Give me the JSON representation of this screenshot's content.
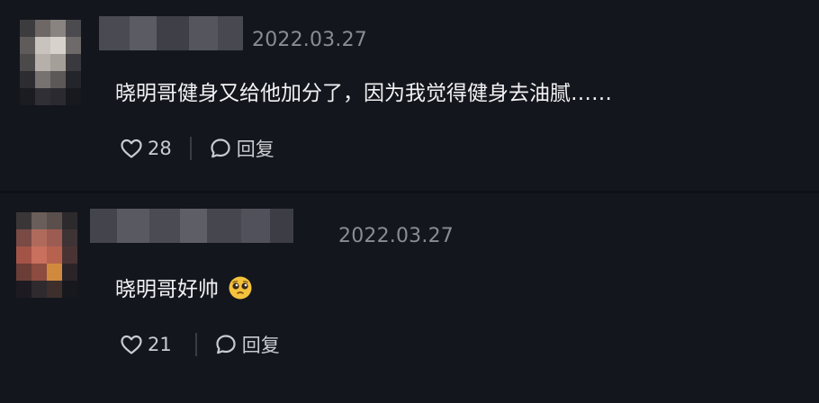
{
  "comments": [
    {
      "date": "2022.03.27",
      "text": "晓明哥健身又给他加分了，因为我觉得健身去油腻……",
      "likes": "28",
      "reply_label": "回复",
      "emoji": ""
    },
    {
      "date": "2022.03.27",
      "text": "晓明哥好帅",
      "likes": "21",
      "reply_label": "回复",
      "emoji": "pleading-face-emoji"
    }
  ],
  "icons": {
    "like": "heart-icon",
    "reply": "chat-bubble-icon"
  },
  "colors": {
    "background": "#14161d",
    "date_text": "#8a8c93",
    "comment_text": "#f2f2f4",
    "action_text": "#c9cbd1"
  }
}
